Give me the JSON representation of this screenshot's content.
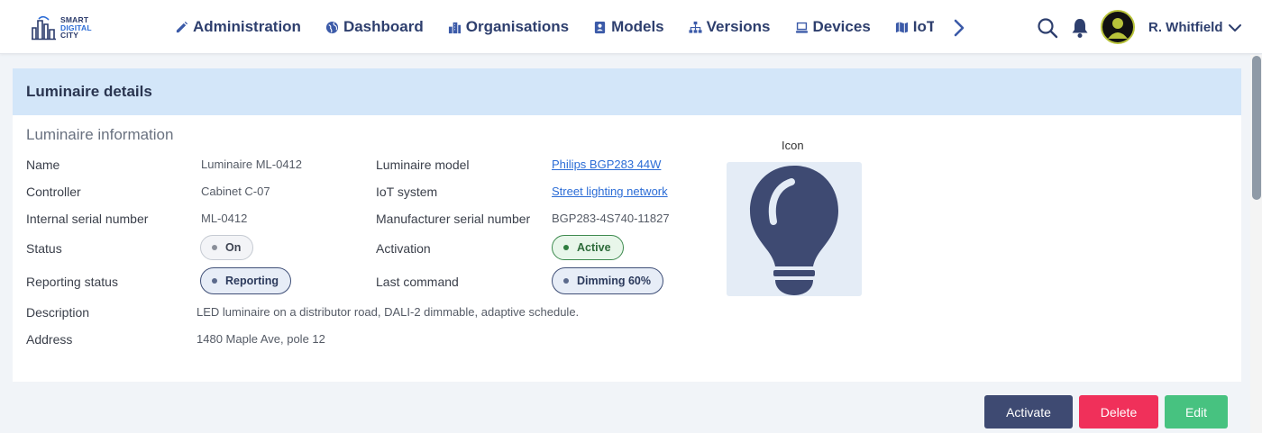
{
  "brand": {
    "line1": "SMART",
    "line2": "DIGITAL",
    "line3": "CITY"
  },
  "nav": {
    "items": [
      {
        "label": "Administration",
        "icon": "pencil-icon"
      },
      {
        "label": "Dashboard",
        "icon": "globe-icon"
      },
      {
        "label": "Organisations",
        "icon": "building-icon"
      },
      {
        "label": "Models",
        "icon": "id-card-icon"
      },
      {
        "label": "Versions",
        "icon": "sitemap-icon"
      },
      {
        "label": "Devices",
        "icon": "monitor-icon"
      },
      {
        "label": "IoT systems",
        "icon": "map-icon"
      }
    ]
  },
  "user": {
    "name": "R. Whitfield"
  },
  "card": {
    "title": "Luminaire details",
    "section_title": "Luminaire information",
    "fields": {
      "name_label": "Name",
      "name_value": "Luminaire ML-0412",
      "controller_label": "Controller",
      "controller_value": "Cabinet C-07",
      "serial_label": "Internal serial number",
      "serial_value": "ML-0412",
      "status_label": "Status",
      "status_value": "On",
      "reporting_label": "Reporting status",
      "reporting_value": "Reporting",
      "model_label": "Luminaire model",
      "model_value": "Philips BGP283 44W",
      "iot_label": "IoT system",
      "iot_value": "Street lighting network",
      "mfr_serial_label": "Manufacturer serial number",
      "mfr_serial_value": "BGP283-4S740-11827",
      "activation_label": "Activation",
      "activation_value": "Active",
      "last_command_label": "Last command",
      "last_command_value": "Dimming 60%",
      "description_label": "Description",
      "description_value": "LED luminaire on a distributor road, DALI-2 dimmable, adaptive schedule.",
      "address_label": "Address",
      "address_value": "1480 Maple Ave, pole 12"
    },
    "icon_caption": "Icon",
    "icon_name": "lightbulb-icon"
  },
  "actions": {
    "activate": "Activate",
    "delete": "Delete",
    "edit": "Edit"
  },
  "colors": {
    "header_bg": "#d3e6f9",
    "activate": "#3e4a72",
    "delete": "#f0305a",
    "edit": "#47c280",
    "bulb": "#3e4a72"
  }
}
